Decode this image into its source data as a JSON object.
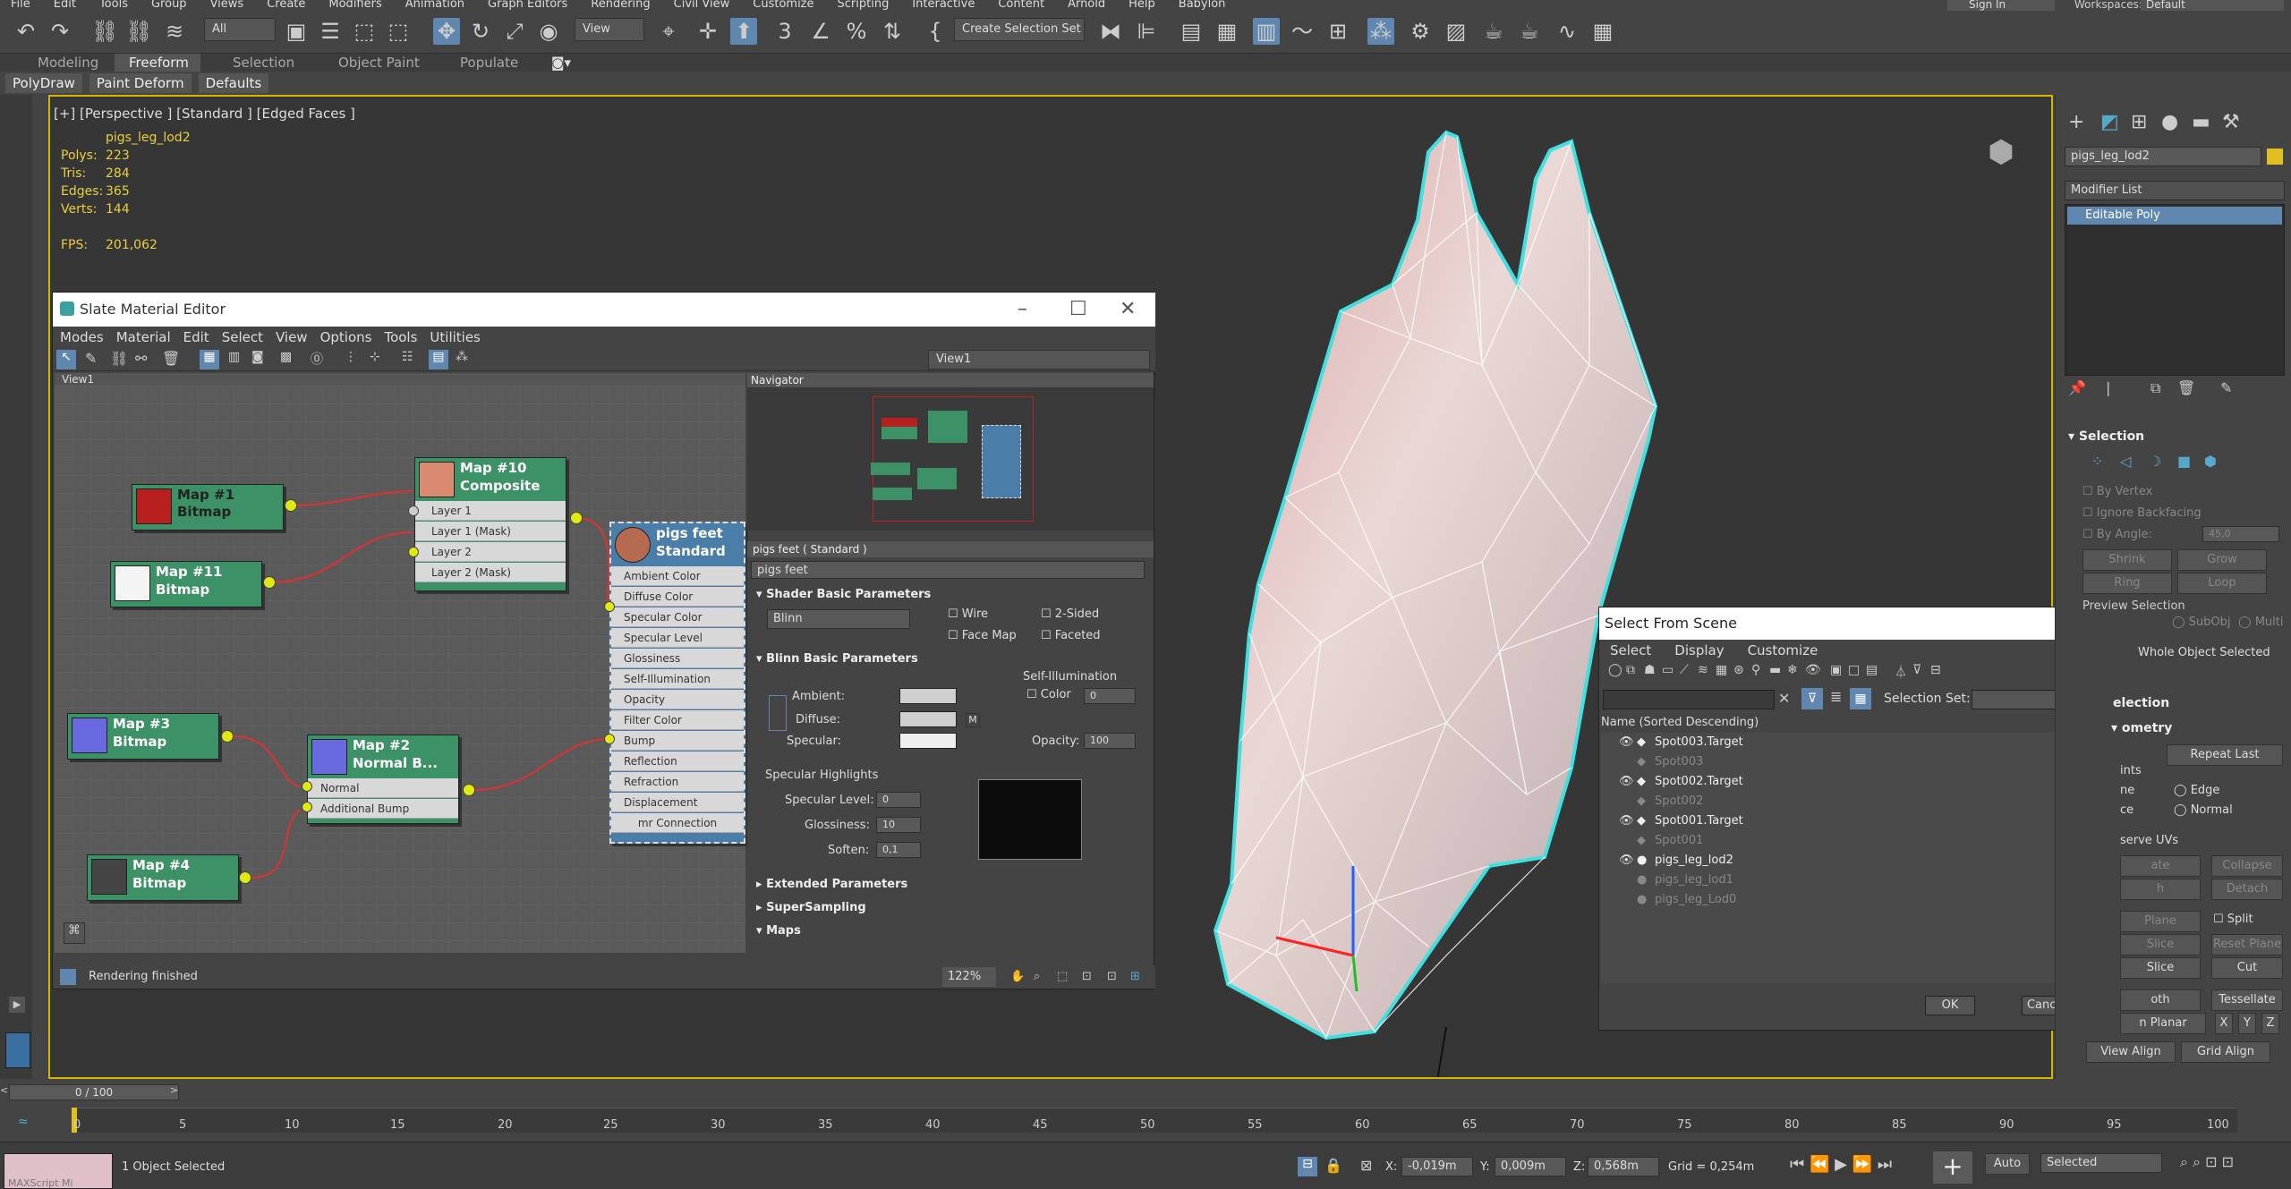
{
  "menu": [
    "File",
    "Edit",
    "Tools",
    "Group",
    "Views",
    "Create",
    "Modifiers",
    "Animation",
    "Graph Editors",
    "Rendering",
    "Civil View",
    "Customize",
    "Scripting",
    "Interactive",
    "Content",
    "Arnold",
    "Help",
    "Babylon"
  ],
  "menu_right": {
    "signin": "Sign In",
    "workspaces_label": "Workspaces:",
    "workspaces_value": "Default"
  },
  "toolbar": {
    "filter": "All",
    "refcoord": "View",
    "selset": "Create Selection Set"
  },
  "ribbon": {
    "tabs": [
      "Modeling",
      "Freeform",
      "Selection",
      "Object Paint",
      "Populate"
    ],
    "active": "Freeform",
    "sub": [
      "PolyDraw",
      "Paint Deform",
      "Defaults"
    ]
  },
  "viewport": {
    "label": "[+] [Perspective ] [Standard ] [Edged Faces ]",
    "object": "pigs_leg_lod2",
    "stats": [
      {
        "k": "Polys:",
        "v": "223"
      },
      {
        "k": "Tris:",
        "v": "284"
      },
      {
        "k": "Edges:",
        "v": "365"
      },
      {
        "k": "Verts:",
        "v": "144"
      }
    ],
    "fps_label": "FPS:",
    "fps": "201,062"
  },
  "slate": {
    "title": "Slate Material Editor",
    "menu": [
      "Modes",
      "Material",
      "Edit",
      "Select",
      "View",
      "Options",
      "Tools",
      "Utilities"
    ],
    "view_tab": "View1",
    "view_dropdown": "View1",
    "nodes": {
      "map1": "Map #1 Bitmap",
      "map11a": "Map #11",
      "map11b": "Bitmap",
      "map10a": "Map #10",
      "map10b": "Composite",
      "map3a": "Map #3",
      "map3b": "Bitmap",
      "map2a": "Map #2",
      "map2b": "Normal B...",
      "map4a": "Map #4",
      "map4b": "Bitmap",
      "pigsa": "pigs feet",
      "pigsb": "Standard"
    },
    "composite_slots": [
      "Layer 1",
      "Layer 1 (Mask)",
      "Layer 2",
      "Layer 2 (Mask)"
    ],
    "normal_slots": [
      "Normal",
      "Additional Bump"
    ],
    "standard_slots": [
      "Ambient Color",
      "Diffuse Color",
      "Specular Color",
      "Specular Level",
      "Glossiness",
      "Self-Illumination",
      "Opacity",
      "Filter Color",
      "Bump",
      "Reflection",
      "Refraction",
      "Displacement",
      "mr Connection"
    ],
    "navigator": "Navigator",
    "props": {
      "header": "pigs feet  ( Standard )",
      "name": "pigs feet",
      "shader_roll": "Shader Basic Parameters",
      "shader": "Blinn",
      "wire": "Wire",
      "twosided": "2-Sided",
      "facemap": "Face Map",
      "faceted": "Faceted",
      "blinn_roll": "Blinn Basic Parameters",
      "selfillum": "Self-Illumination",
      "color": "Color",
      "color_val": "0",
      "ambient": "Ambient:",
      "diffuse": "Diffuse:",
      "specular": "Specular:",
      "m": "M",
      "opacity": "Opacity:",
      "opacity_val": "100",
      "spec_high": "Specular Highlights",
      "spec_level": "Specular Level:",
      "spec_level_val": "0",
      "gloss": "Glossiness:",
      "gloss_val": "10",
      "soften": "Soften:",
      "soften_val": "0,1",
      "extended": "Extended Parameters",
      "supersampling": "SuperSampling",
      "maps": "Maps"
    },
    "status": "Rendering finished",
    "zoom": "122%"
  },
  "sfs": {
    "title": "Select From Scene",
    "menu": [
      "Select",
      "Display",
      "Customize"
    ],
    "selset_label": "Selection Set:",
    "column": "Name (Sorted Descending)",
    "rows": [
      {
        "name": "Spot003.Target",
        "dim": false
      },
      {
        "name": "Spot003",
        "dim": true
      },
      {
        "name": "Spot002.Target",
        "dim": false
      },
      {
        "name": "Spot002",
        "dim": true
      },
      {
        "name": "Spot001.Target",
        "dim": false
      },
      {
        "name": "Spot001",
        "dim": true
      },
      {
        "name": "pigs_leg_lod2",
        "dim": false
      },
      {
        "name": "pigs_leg_lod1",
        "dim": true
      },
      {
        "name": "pigs_leg_Lod0",
        "dim": true
      }
    ],
    "ok": "OK",
    "cancel": "Cancel"
  },
  "cmd": {
    "object_name": "pigs_leg_lod2",
    "modifier_list": "Modifier List",
    "stack_item": "Editable Poly",
    "selection_roll": "Selection",
    "by_vertex": "By Vertex",
    "ignore_back": "Ignore Backfacing",
    "by_angle": "By Angle:",
    "angle_val": "45,0",
    "shrink": "Shrink",
    "grow": "Grow",
    "ring": "Ring",
    "loop": "Loop",
    "preview": "Preview Selection",
    "subobj": "SubObj",
    "multi": "Multi",
    "whole_obj": "Whole Object Selected",
    "soft_sel": "election",
    "geometry": "ometry",
    "repeat_last": "Repeat Last",
    "constraints": "ints",
    "none": "ne",
    "edge": "Edge",
    "face": "ce",
    "normal": "Normal",
    "preserve": "serve UVs",
    "create": "ate",
    "collapse": "Collapse",
    "attach": "h",
    "detach": "Detach",
    "slice_plane": "Plane",
    "split": "Split",
    "slice": "Slice",
    "reset_plane": "Reset Plane",
    "quickslice": "Slice",
    "cut": "Cut",
    "msmooth": "oth",
    "tessellate": "Tessellate",
    "make_planar": "n Planar",
    "x": "X",
    "y": "Y",
    "z": "Z",
    "view_align": "View Align",
    "grid_align": "Grid Align"
  },
  "timeline": {
    "frame": "0 / 100",
    "ticks": [
      "0",
      "5",
      "10",
      "15",
      "20",
      "25",
      "30",
      "35",
      "40",
      "45",
      "50",
      "55",
      "60",
      "65",
      "70",
      "75",
      "80",
      "85",
      "90",
      "95",
      "100"
    ]
  },
  "statusbar": {
    "selected": "1 Object Selected",
    "maxscript": "MAXScript Mi",
    "x_label": "X:",
    "x": "-0,019m",
    "y_label": "Y:",
    "y": "0,009m",
    "z_label": "Z:",
    "z": "0,568m",
    "grid": "Grid = 0,254m",
    "auto": "Auto",
    "keymode": "Selected"
  },
  "colors": {
    "accent": "#5f87b0",
    "node": "#3c9166",
    "selection": "#d6b400",
    "highlight": "#40e0e0"
  }
}
